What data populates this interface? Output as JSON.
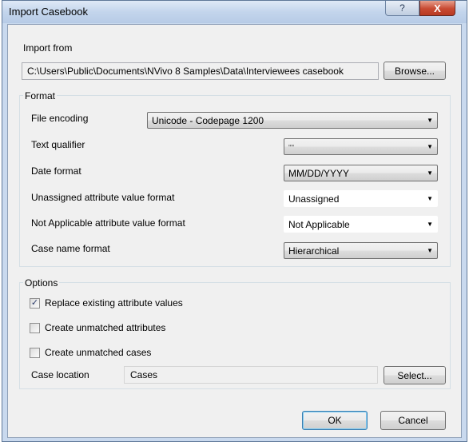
{
  "window": {
    "title": "Import Casebook",
    "help_icon": "?",
    "close_icon": "X"
  },
  "import_from": {
    "label": "Import from",
    "path": "C:\\Users\\Public\\Documents\\NVivo 8 Samples\\Data\\Interviewees casebook",
    "browse_label": "Browse..."
  },
  "format": {
    "label": "Format",
    "file_encoding": {
      "label": "File encoding",
      "value": "Unicode - Codepage 1200"
    },
    "text_qualifier": {
      "label": "Text qualifier",
      "value": "\"\""
    },
    "date_format": {
      "label": "Date format",
      "value": "MM/DD/YYYY"
    },
    "unassigned": {
      "label": "Unassigned attribute value format",
      "value": "Unassigned"
    },
    "not_applicable": {
      "label": "Not Applicable attribute value format",
      "value": "Not Applicable"
    },
    "case_name": {
      "label": "Case name format",
      "value": "Hierarchical"
    }
  },
  "options": {
    "label": "Options",
    "replace_existing": {
      "label": "Replace existing attribute values",
      "checked": true
    },
    "create_attributes": {
      "label": "Create unmatched attributes",
      "checked": false
    },
    "create_cases": {
      "label": "Create unmatched cases",
      "checked": false
    },
    "case_location": {
      "label": "Case location",
      "value": "Cases",
      "select_label": "Select..."
    }
  },
  "footer": {
    "ok_label": "OK",
    "cancel_label": "Cancel"
  },
  "icons": {
    "dropdown": "chevron-down-icon",
    "check": "checkmark-icon"
  }
}
